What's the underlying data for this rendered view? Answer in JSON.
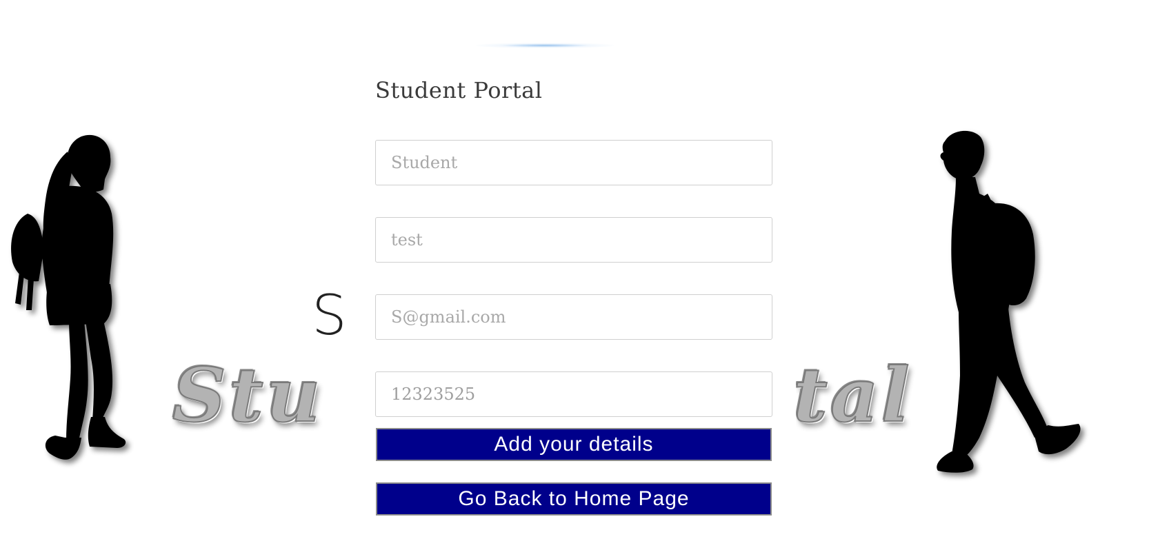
{
  "app": {
    "title": "Student Portal"
  },
  "background": {
    "banner_first_letter": "S",
    "banner_script_left": "Stu",
    "banner_script_right": "tal"
  },
  "form": {
    "title": "Student Portal",
    "fields": [
      {
        "name": "name",
        "value": "",
        "placeholder": "Student"
      },
      {
        "name": "password",
        "value": "",
        "placeholder": "test"
      },
      {
        "name": "email",
        "value": "",
        "placeholder": "S@gmail.com"
      },
      {
        "name": "phone",
        "value": "12323525",
        "placeholder": ""
      }
    ],
    "add_button_label": "Add your details",
    "home_button_label": "Go Back to Home Page"
  },
  "colors": {
    "button_bg": "#00008b",
    "button_text": "#ffffff",
    "silhouette": "#000000"
  },
  "icons": {
    "left_figure": "girl-silhouette-icon",
    "right_figure": "boy-silhouette-icon"
  }
}
